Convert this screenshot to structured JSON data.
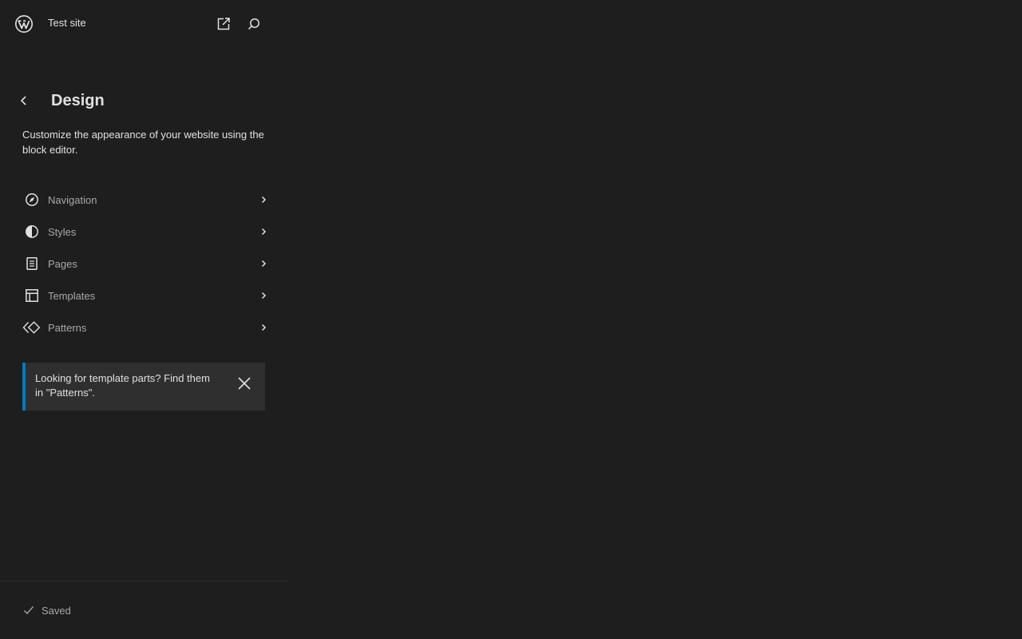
{
  "header": {
    "site_title": "Test site",
    "logo_icon": "wordpress-logo-icon",
    "view_site_icon": "external-link-icon",
    "search_icon": "search-icon"
  },
  "panel": {
    "back_icon": "chevron-left-icon",
    "title": "Design",
    "description": "Customize the appearance of your website using the block editor."
  },
  "menu": {
    "items": [
      {
        "label": "Navigation",
        "icon": "compass-icon"
      },
      {
        "label": "Styles",
        "icon": "half-circle-icon"
      },
      {
        "label": "Pages",
        "icon": "page-icon"
      },
      {
        "label": "Templates",
        "icon": "layout-icon"
      },
      {
        "label": "Patterns",
        "icon": "diamond-icon"
      }
    ]
  },
  "notice": {
    "text": "Looking for template parts? Find them in \"Patterns\".",
    "close_icon": "close-icon",
    "accent_color": "#007cba"
  },
  "footer": {
    "status": "Saved",
    "status_icon": "check-icon"
  },
  "colors": {
    "background": "#1e1e1e",
    "text": "#e0e0e0",
    "muted": "#a8a8a8",
    "accent": "#007cba"
  }
}
